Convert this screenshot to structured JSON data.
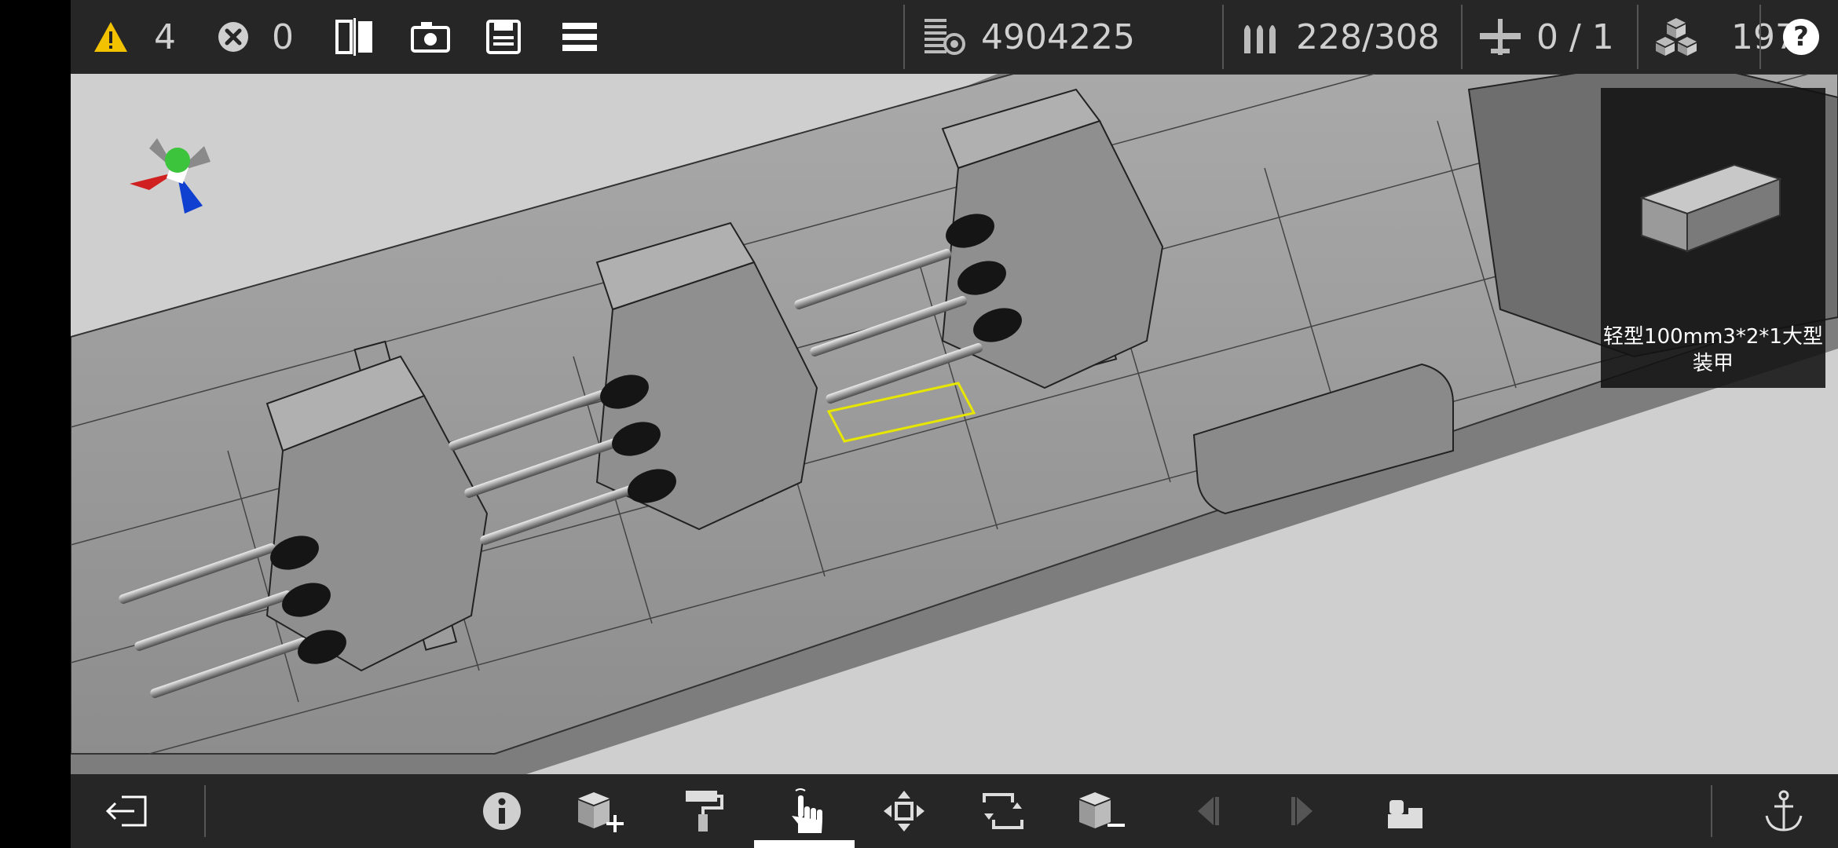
{
  "topbar": {
    "warnings": "4",
    "errors": "0",
    "hull_points": "4904225",
    "ammo": "228/308",
    "aircraft": "0 / 1",
    "parts": "1974",
    "help_label": "?"
  },
  "selected_part": {
    "name": "轻型100mm3*2*1大型装甲"
  },
  "colors": {
    "bar_bg": "#262626",
    "viewport_bg": "#cfcfcf",
    "warning": "#f2c200",
    "selection_outline": "#e6e600",
    "axis_x": "#d02020",
    "axis_y": "#3cc43c",
    "axis_z": "#1040d0"
  },
  "icons": {
    "top": [
      "warning-icon",
      "error-icon",
      "mirror-icon",
      "camera-icon",
      "save-icon",
      "menu-icon",
      "armor-icon",
      "ammo-icon",
      "aircraft-icon",
      "parts-icon",
      "help-icon"
    ],
    "bottom": [
      "exit-icon",
      "info-icon",
      "add-part-icon",
      "paint-roller-icon",
      "select-hand-icon",
      "move-icon",
      "rotate-icon",
      "remove-part-icon",
      "undo-icon",
      "redo-icon",
      "fold-icon",
      "anchor-icon"
    ]
  }
}
